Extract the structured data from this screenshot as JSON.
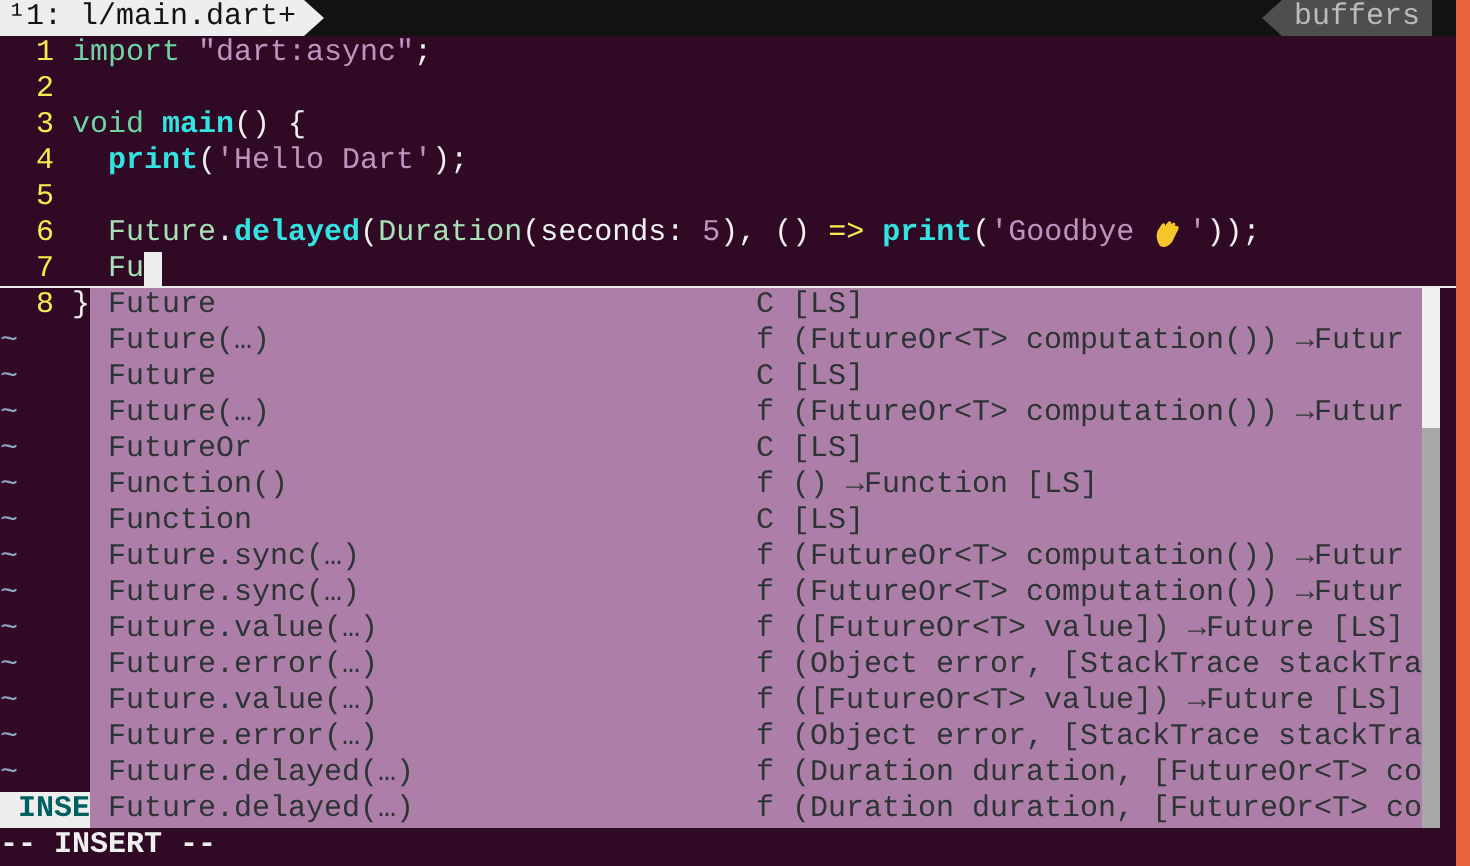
{
  "tabline": {
    "tab_label": "¹1: l/main.dart+",
    "buffers_label": "buffers"
  },
  "lines": [
    {
      "number": "1",
      "current": false,
      "indented": false,
      "tokens": [
        {
          "text": "import",
          "kind": "keyword"
        },
        {
          "text": " \"dart:async\"",
          "kind": "string"
        },
        {
          "text": ";",
          "kind": "plain"
        }
      ]
    },
    {
      "number": "2",
      "current": false
    },
    {
      "number": "3",
      "current": false,
      "indented": false,
      "tokens": [
        {
          "text": "void",
          "kind": "keyword"
        },
        {
          "text": " main",
          "kind": "function"
        },
        {
          "text": "() {",
          "kind": "plain"
        }
      ]
    },
    {
      "number": "4",
      "current": false,
      "indented": true,
      "tokens": [
        {
          "text": "print",
          "kind": "function"
        },
        {
          "text": "(",
          "kind": "plain"
        },
        {
          "text": "'Hello Dart'",
          "kind": "string"
        },
        {
          "text": ");",
          "kind": "plain"
        }
      ]
    },
    {
      "number": "5",
      "current": false
    },
    {
      "number": "6",
      "current": false,
      "indented": true,
      "tokens": [
        {
          "text": "Future",
          "kind": "type"
        },
        {
          "text": ".",
          "kind": "plain"
        },
        {
          "text": "delayed",
          "kind": "function"
        },
        {
          "text": "(",
          "kind": "plain"
        },
        {
          "text": "Duration",
          "kind": "type"
        },
        {
          "text": "(seconds: ",
          "kind": "plain"
        },
        {
          "text": "5",
          "kind": "string"
        },
        {
          "text": "), () ",
          "kind": "plain"
        },
        {
          "text": "=>",
          "kind": "operator"
        },
        {
          "text": " print",
          "kind": "function"
        },
        {
          "text": "(",
          "kind": "plain"
        },
        {
          "text": "'Goodbye ",
          "kind": "string"
        },
        {
          "kind": "wave"
        },
        {
          "text": "'",
          "kind": "string"
        },
        {
          "text": "));",
          "kind": "plain"
        }
      ]
    },
    {
      "number": "7",
      "current": true,
      "indented": true,
      "tokens": [
        {
          "text": "Fu",
          "kind": "type"
        }
      ]
    },
    {
      "number": "8",
      "current": false,
      "indented": false,
      "tokens": [
        {
          "text": "}",
          "kind": "plain"
        }
      ]
    }
  ],
  "tildes": [
    "~",
    "~",
    "~",
    "~",
    "~",
    "~",
    "~",
    "~",
    "~",
    "~",
    "~",
    "~",
    "~"
  ],
  "popup": [
    {
      "word": "Future",
      "menu": "C [LS]",
      "selected": false
    },
    {
      "word": "Future(…)",
      "menu": "f (FutureOr<T> computation()) →Futur",
      "selected": false
    },
    {
      "word": "Future",
      "menu": "C [LS]",
      "selected": false
    },
    {
      "word": "Future(…)",
      "menu": "f (FutureOr<T> computation()) →Futur",
      "selected": false
    },
    {
      "word": "FutureOr",
      "menu": "C [LS]",
      "selected": false
    },
    {
      "word": "Function()",
      "menu": "f () →Function [LS]",
      "selected": false
    },
    {
      "word": "Function",
      "menu": "C [LS]",
      "selected": false
    },
    {
      "word": "Future.sync(…)",
      "menu": "f (FutureOr<T> computation()) →Futur",
      "selected": false
    },
    {
      "word": "Future.sync(…)",
      "menu": "f (FutureOr<T> computation()) →Futur",
      "selected": false
    },
    {
      "word": "Future.value(…)",
      "menu": "f ([FutureOr<T> value]) →Future [LS]",
      "selected": false
    },
    {
      "word": "Future.error(…)",
      "menu": "f (Object error, [StackTrace stackTra",
      "selected": false
    },
    {
      "word": "Future.value(…)",
      "menu": "f ([FutureOr<T> value]) →Future [LS]",
      "selected": false
    },
    {
      "word": "Future.error(…)",
      "menu": "f (Object error, [StackTrace stackTra",
      "selected": false
    },
    {
      "word": "Future.delayed(…)",
      "menu": "f (Duration duration, [FutureOr<T> co",
      "selected": false
    },
    {
      "word": "Future.delayed(…)",
      "menu": "f (Duration duration, [FutureOr<T> co",
      "selected": false
    }
  ],
  "status_line": "INSE",
  "command_line": "-- INSERT --"
}
